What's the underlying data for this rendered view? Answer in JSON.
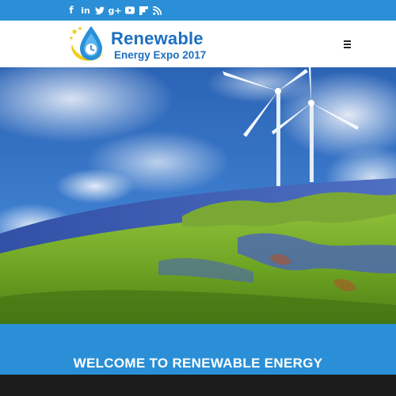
{
  "social": {
    "facebook": "f",
    "linkedin": "in",
    "twitter": "🐦",
    "googleplus": "g+",
    "youtube": "▶",
    "flipboard": "F",
    "rss": "RSS"
  },
  "logo": {
    "line1": "Renewable",
    "line2": "Energy Expo 2017"
  },
  "welcome": {
    "title": "WELCOME TO RENEWABLE ENERGY"
  },
  "colors": {
    "accent": "#2a8fd6",
    "brand_text": "#1e6fbf"
  }
}
